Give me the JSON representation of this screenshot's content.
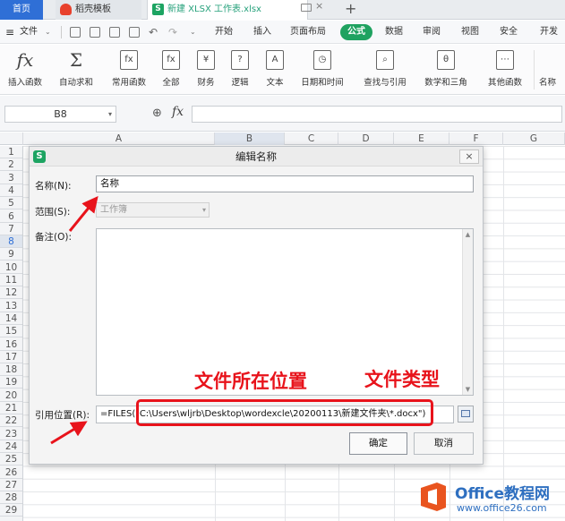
{
  "tabs": {
    "home": "首页",
    "template": "稻壳模板",
    "file": "新建 XLSX 工作表.xlsx",
    "file_icon": "S",
    "close_glyph": "×",
    "add_glyph": "+"
  },
  "menubar": {
    "file_label": "文件",
    "items": [
      "开始",
      "插入",
      "页面布局",
      "公式",
      "数据",
      "审阅",
      "视图",
      "安全",
      "开发"
    ],
    "active": "公式",
    "active_color": "#1fa260"
  },
  "ribbon": {
    "items": [
      {
        "icon": "fx",
        "label": "插入函数"
      },
      {
        "icon": "Σ",
        "label": "自动求和"
      },
      {
        "icon": "fx",
        "label": "常用函数"
      },
      {
        "icon": "fx",
        "label": "全部"
      },
      {
        "icon": "¥",
        "label": "财务"
      },
      {
        "icon": "?",
        "label": "逻辑"
      },
      {
        "icon": "A",
        "label": "文本"
      },
      {
        "icon": "◷",
        "label": "日期和时间"
      },
      {
        "icon": "⌕",
        "label": "查找与引用"
      },
      {
        "icon": "θ",
        "label": "数学和三角"
      },
      {
        "icon": "⋯",
        "label": "其他函数"
      },
      {
        "icon": "",
        "label": "名称"
      }
    ]
  },
  "formula_bar": {
    "name_box": "B8",
    "fx": "fx",
    "value": ""
  },
  "sheet": {
    "columns": [
      "A",
      "B",
      "C",
      "D",
      "E",
      "F",
      "G"
    ],
    "selected_column": "B",
    "rows": [
      "1",
      "2",
      "3",
      "4",
      "5",
      "6",
      "7",
      "8",
      "9",
      "10",
      "11",
      "12",
      "13",
      "14",
      "15",
      "16",
      "17",
      "18",
      "19",
      "20",
      "21",
      "22",
      "23",
      "24",
      "25",
      "26",
      "27",
      "28",
      "29"
    ],
    "selected_row": "8"
  },
  "dialog": {
    "icon": "S",
    "title": "编辑名称",
    "close": "×",
    "name_label": "名称(N):",
    "name_value": "名称",
    "scope_label": "范围(S):",
    "scope_value": "工作簿",
    "comment_label": "备注(O):",
    "refers_label": "引用位置(R):",
    "refers_value": "=FILES(\"C:\\Users\\wljrb\\Desktop\\wordexcle\\20200113\\新建文件夹\\*.docx\")",
    "ok": "确定",
    "cancel": "取消"
  },
  "annotations": {
    "location_text": "文件所在位置",
    "type_text": "文件类型",
    "color": "#e8131b"
  },
  "watermark": {
    "title": "Office教程网",
    "url": "www.office26.com"
  }
}
